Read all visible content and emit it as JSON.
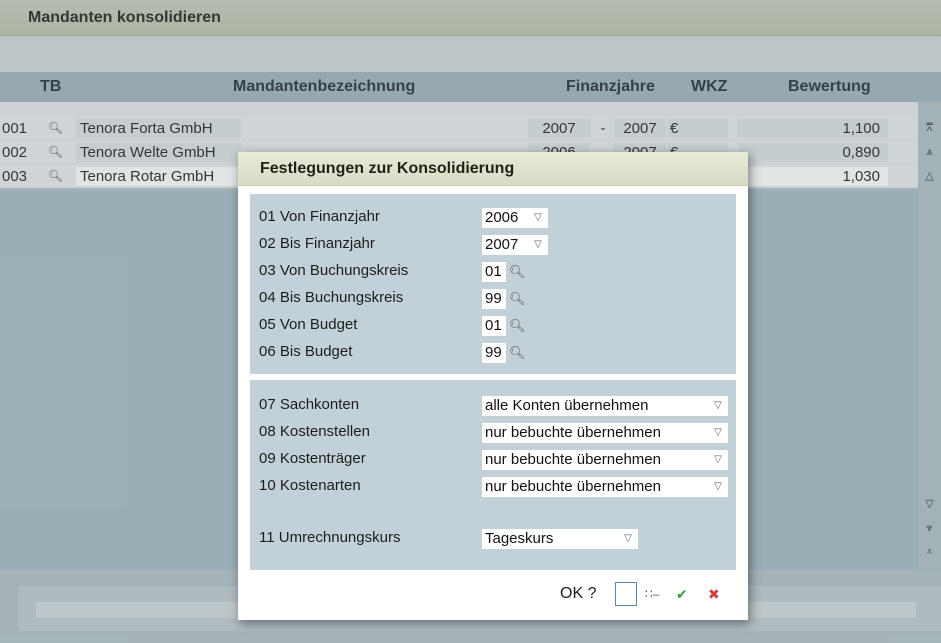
{
  "window": {
    "title": "Mandanten konsolidieren"
  },
  "columns": {
    "tb": "TB",
    "name": "Mandantenbezeichnung",
    "finanzjahre": "Finanzjahre",
    "wkz": "WKZ",
    "bewertung": "Bewertung"
  },
  "rows": [
    {
      "nr": "001",
      "name": "Tenora Forta GmbH",
      "fy_from": "2007",
      "dash": "-",
      "fy_to": "2007",
      "currency": "€",
      "value": "1,100"
    },
    {
      "nr": "002",
      "name": "Tenora Welte GmbH",
      "fy_from": "2006",
      "dash": "-",
      "fy_to": "2007",
      "currency": "€",
      "value": "0,890"
    },
    {
      "nr": "003",
      "name": "Tenora Rotar GmbH",
      "fy_from": "",
      "dash": "",
      "fy_to": "",
      "currency": "",
      "value": "1,030"
    }
  ],
  "dialog": {
    "title": "Festlegungen zur Konsolidierung",
    "fields": [
      {
        "label": "01 Von Finanzjahr",
        "value": "2006"
      },
      {
        "label": "02 Bis Finanzjahr",
        "value": "2007"
      },
      {
        "label": "03 Von Buchungskreis",
        "value": "01"
      },
      {
        "label": "04 Bis Buchungskreis",
        "value": "99"
      },
      {
        "label": "05 Von Budget",
        "value": "01"
      },
      {
        "label": "06 Bis Budget",
        "value": "99"
      }
    ],
    "options": [
      {
        "label": "07 Sachkonten",
        "value": "alle Konten übernehmen"
      },
      {
        "label": "08 Kostenstellen",
        "value": "nur bebuchte übernehmen"
      },
      {
        "label": "09 Kostenträger",
        "value": "nur bebuchte übernehmen"
      },
      {
        "label": "10 Kostenarten",
        "value": "nur bebuchte übernehmen"
      }
    ],
    "rate": {
      "label": "11 Umrechnungskurs",
      "value": "Tageskurs"
    },
    "ok_label": "OK ?"
  },
  "icons": {
    "search": "magnifier-icon",
    "dropdown": "triangle-down-icon",
    "confirm": "check-icon",
    "cancel": "x-icon",
    "list": "list-icon"
  },
  "colors": {
    "confirm": "#3c9a3c",
    "cancel": "#d04040",
    "header": "#a4b8c0"
  }
}
